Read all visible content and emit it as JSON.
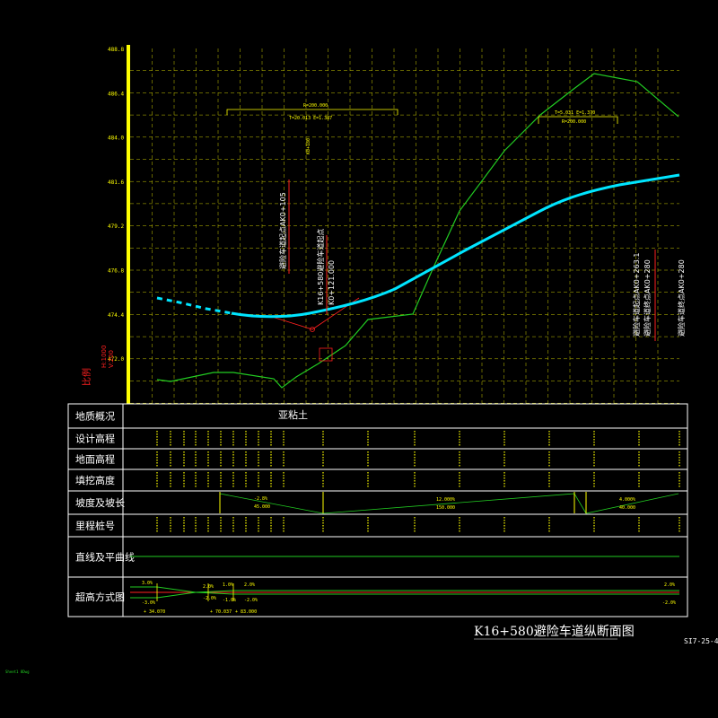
{
  "drawing": {
    "title": "K16+580避险车道纵断面图",
    "sheet_no": "SI7-25-4",
    "corner_note": "Sheet1 8Dwg",
    "scale_label_1": "比例",
    "scale_label_2": "H:1000",
    "scale_label_3": "V:200"
  },
  "elevation_ticks": [
    "488.8",
    "486.4",
    "484.0",
    "481.6",
    "479.2",
    "476.8",
    "474.4",
    "472.0"
  ],
  "table_rows": [
    {
      "key": "geology",
      "label": "地质概况"
    },
    {
      "key": "design",
      "label": "设计高程"
    },
    {
      "key": "ground",
      "label": "地面高程"
    },
    {
      "key": "cutfill",
      "label": "填挖高度"
    },
    {
      "key": "grade",
      "label": "坡度及坡长"
    },
    {
      "key": "station",
      "label": "里程桩号"
    },
    {
      "key": "alignment",
      "label": "直线及平曲线"
    },
    {
      "key": "superelev",
      "label": "超高方式图"
    }
  ],
  "geology_value": "亚粘土",
  "annotations": {
    "left_vertical": "避险车道起点AK0+105",
    "mid_vertical_1": "K16+580避险车道起点",
    "mid_vertical_2": "K0+121.000",
    "right_vertical_1": "避险车道起点AK0+263.1",
    "right_vertical_2": "避险车道终点AK0+280",
    "curve1_r": "R=200.000",
    "curve1_t": "T=20.013 E=1.387",
    "curve2_r": "R=200.000",
    "curve2_t": "T=5.031 E=1.370",
    "peak_label": "K0+180",
    "grade_1": "-2.8%",
    "grade_1_len": "45.000",
    "grade_2": "12.000%",
    "grade_2_len": "150.000",
    "grade_3": "4.000%",
    "grade_3_len": "40.000",
    "super_left_top": "3.0%",
    "super_left_bot": "-3.0%",
    "super_mid_1": "2.0%",
    "super_mid_2": "1.0%",
    "super_mid_3": "2.0%",
    "super_mid_4": "-1.0%",
    "super_mid_5": "-2.0%",
    "super_right_top": "2.0%",
    "super_right_bot": "-2.0%",
    "super_st_1": "+ 34.070",
    "super_st_2": "+ 70.037",
    "super_st_3": "+ 83.000"
  },
  "colors": {
    "grid": "#c8c800",
    "design_line": "#00e5ff",
    "ground_line": "#22cc22",
    "axis": "#ffff00",
    "red": "#ff2020",
    "white": "#ffffff"
  }
}
